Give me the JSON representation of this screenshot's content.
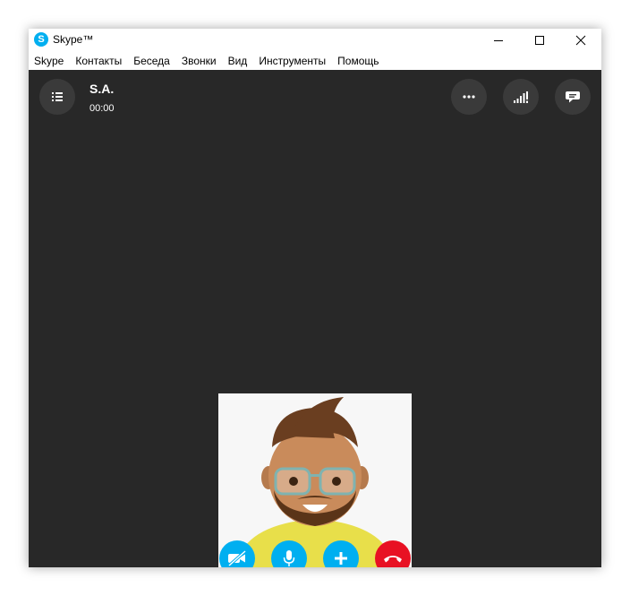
{
  "window": {
    "title": "Skype™",
    "logo_letter": "S"
  },
  "menu": {
    "items": [
      "Skype",
      "Контакты",
      "Беседа",
      "Звонки",
      "Вид",
      "Инструменты",
      "Помощь"
    ]
  },
  "call": {
    "contact_name": "S.A.",
    "timer": "00:00"
  },
  "icons": {
    "menu": "list-menu-icon",
    "more": "more-dots-icon",
    "signal": "signal-strength-icon",
    "chat": "chat-bubble-icon",
    "video_off": "video-off-icon",
    "mic": "microphone-icon",
    "add": "plus-icon",
    "hangup": "hang-up-icon"
  },
  "colors": {
    "call_background": "#282828",
    "button_dark": "#3a3a3a",
    "accent_blue": "#00aff0",
    "hangup_red": "#e81123"
  }
}
